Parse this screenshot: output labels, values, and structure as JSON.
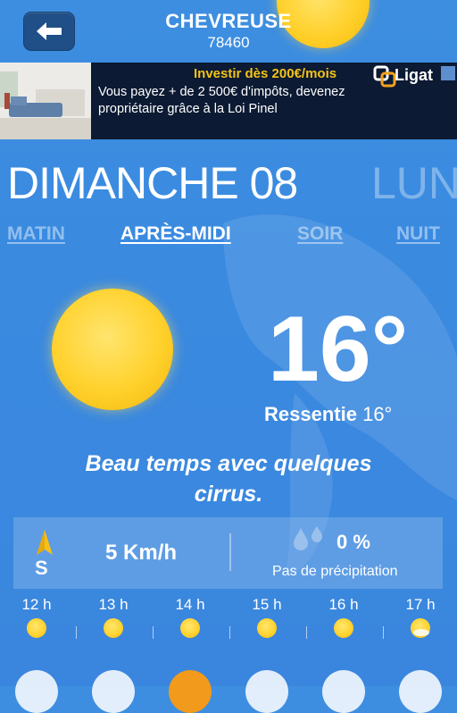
{
  "header": {
    "city": "CHEVREUSE",
    "zip": "78460"
  },
  "ad": {
    "title": "Investir dès 200€/mois",
    "text": "Vous payez + de 2 500€ d'impôts, devenez propriétaire grâce à la Loi Pinel",
    "brand": "Ligat"
  },
  "day": {
    "current": "DIMANCHE 08",
    "next": "LUN"
  },
  "periods": {
    "matin": "MATIN",
    "apres_midi": "APRÈS-MIDI",
    "soir": "SOIR",
    "nuit": "NUIT"
  },
  "weather": {
    "temperature": "16°",
    "feel_label": "Ressentie",
    "feel_value": "16°",
    "description": "Beau temps avec quelques cirrus.",
    "wind_direction": "S",
    "wind_speed": "5 Km/h",
    "precip_pct": "0 %",
    "precip_text": "Pas de précipitation"
  },
  "hourly": [
    {
      "hour": "12 h",
      "icon": "sun-icon"
    },
    {
      "hour": "13 h",
      "icon": "sun-icon"
    },
    {
      "hour": "14 h",
      "icon": "sun-icon"
    },
    {
      "hour": "15 h",
      "icon": "sun-icon"
    },
    {
      "hour": "16 h",
      "icon": "sun-icon"
    },
    {
      "hour": "17 h",
      "icon": "sun-cloud-icon"
    }
  ],
  "colors": {
    "accent_yellow": "#f4c317",
    "sun": "#ffd12c",
    "active_bubble": "#f29a1b"
  }
}
